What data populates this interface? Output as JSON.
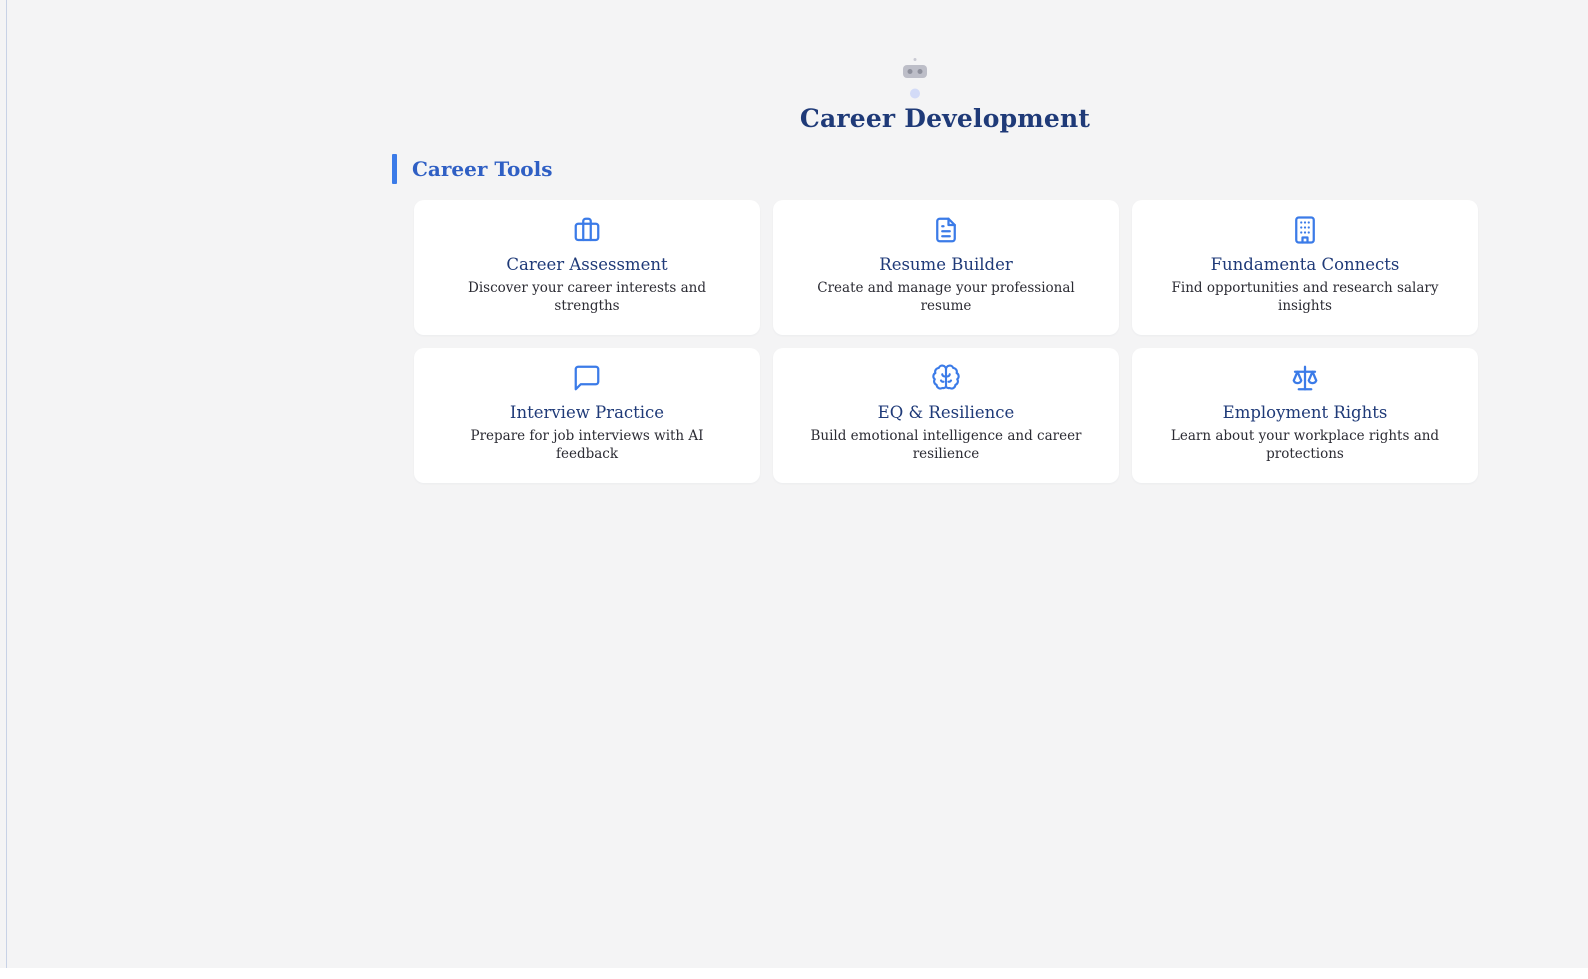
{
  "page": {
    "title": "Career Development",
    "mascot_icon": "robot-icon"
  },
  "section": {
    "heading": "Career Tools"
  },
  "colors": {
    "accent": "#3b7be8",
    "title": "#1f3a78",
    "background": "#f4f4f5",
    "card": "#ffffff"
  },
  "tools": [
    {
      "icon": "briefcase-icon",
      "title": "Career Assessment",
      "description": "Discover your career interests and strengths"
    },
    {
      "icon": "document-icon",
      "title": "Resume Builder",
      "description": "Create and manage your professional resume"
    },
    {
      "icon": "building-icon",
      "title": "Fundamenta Connects",
      "description": "Find opportunities and research salary insights"
    },
    {
      "icon": "chat-bubble-icon",
      "title": "Interview Practice",
      "description": "Prepare for job interviews with AI feedback"
    },
    {
      "icon": "brain-icon",
      "title": "EQ & Resilience",
      "description": "Build emotional intelligence and career resilience"
    },
    {
      "icon": "scale-icon",
      "title": "Employment Rights",
      "description": "Learn about your workplace rights and protections"
    }
  ]
}
